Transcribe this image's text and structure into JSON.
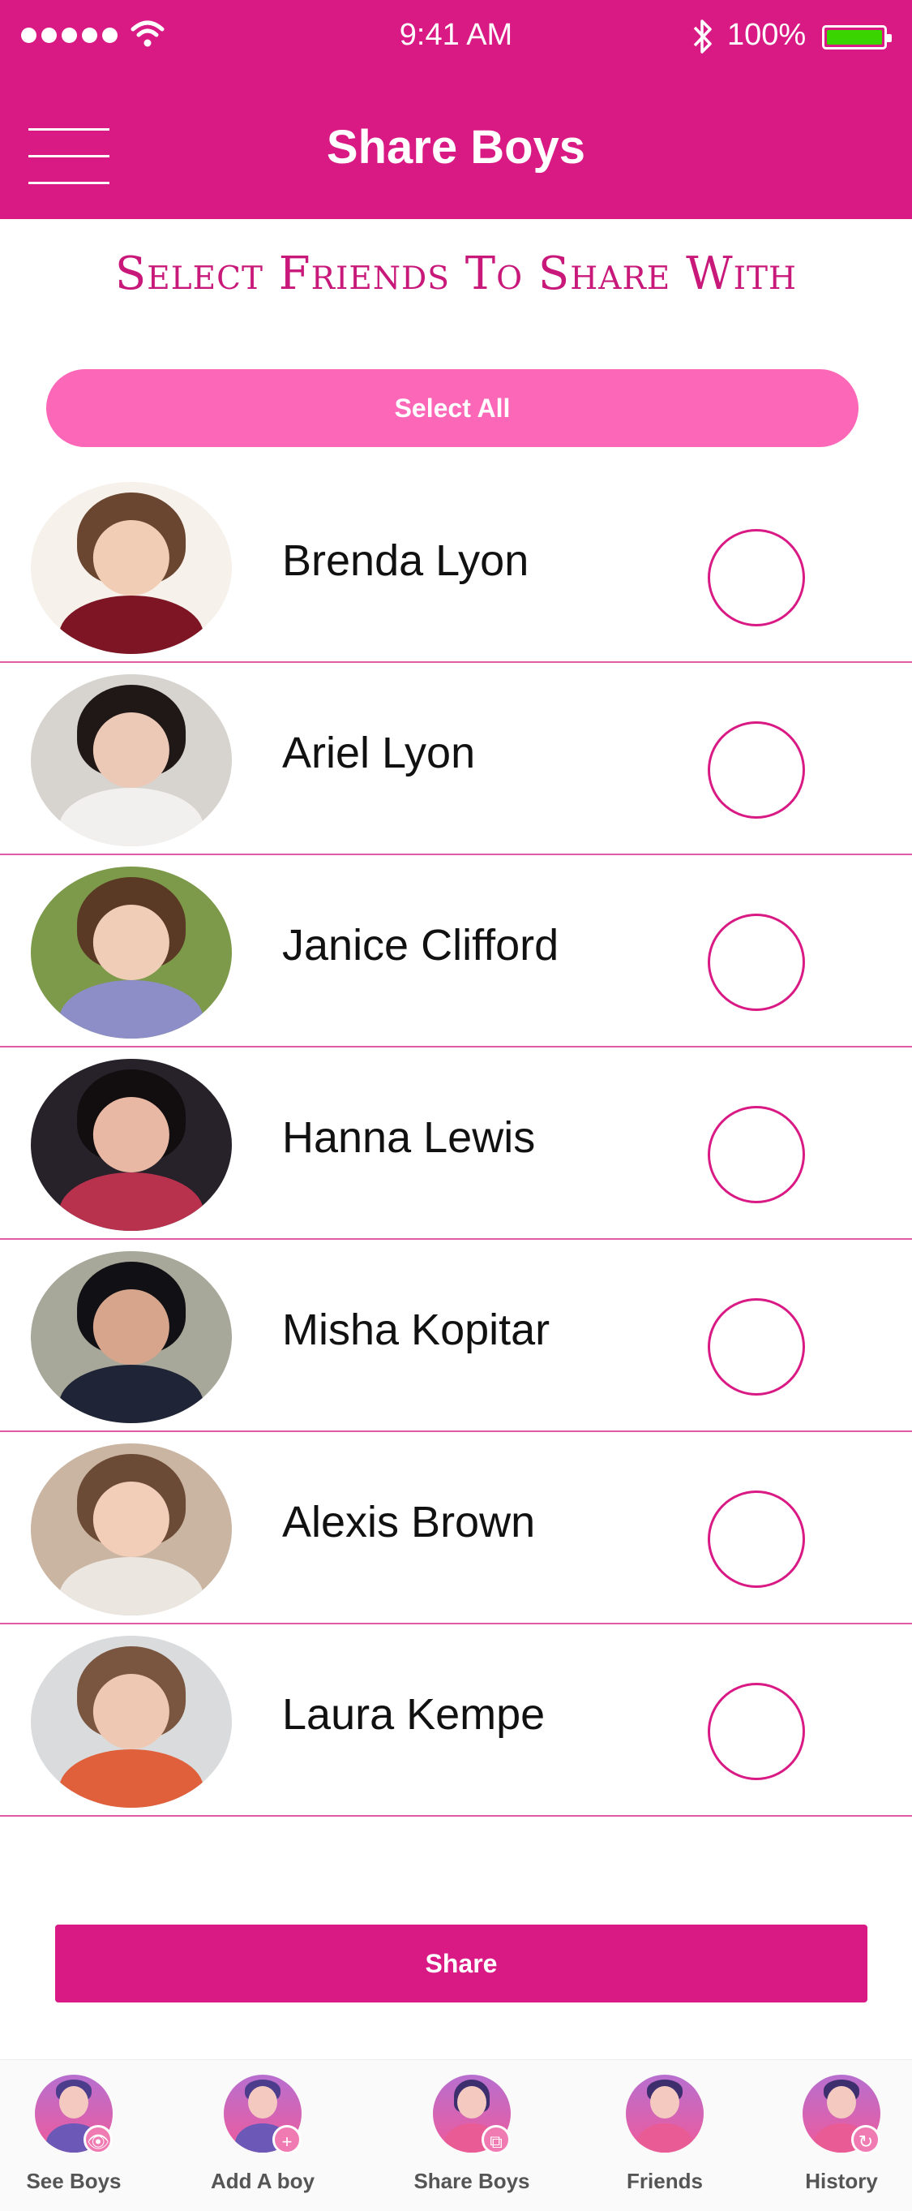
{
  "status": {
    "time": "9:41 AM",
    "battery": "100%"
  },
  "header": {
    "title": "Share Boys"
  },
  "page": {
    "subtitle": "Select Friends To Share With",
    "select_all_label": "Select All",
    "share_label": "Share"
  },
  "friends": [
    {
      "name": "Brenda Lyon"
    },
    {
      "name": "Ariel Lyon"
    },
    {
      "name": "Janice Clifford"
    },
    {
      "name": "Hanna Lewis"
    },
    {
      "name": "Misha Kopitar"
    },
    {
      "name": "Alexis Brown"
    },
    {
      "name": "Laura Kempe"
    }
  ],
  "tabs": [
    {
      "label": "See Boys",
      "icon": "eye-icon"
    },
    {
      "label": "Add A boy",
      "icon": "plus-icon"
    },
    {
      "label": "Share Boys",
      "icon": "share-icon"
    },
    {
      "label": "Friends",
      "icon": "friends-icon"
    },
    {
      "label": "History",
      "icon": "history-icon"
    }
  ],
  "colors": {
    "primary": "#d91a84",
    "select_all": "#fd67b7",
    "battery_fill": "#3ad400"
  }
}
